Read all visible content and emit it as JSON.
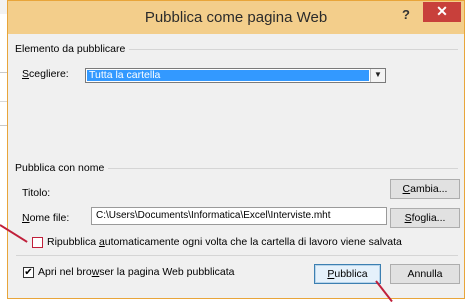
{
  "dialog": {
    "title": "Pubblica come pagina Web",
    "help_label": "?",
    "close_label": "✕"
  },
  "section_publish": {
    "group_label": "Elemento da pubblicare",
    "choose_label": "Scegliere:",
    "choose_label_accel": "S",
    "choose_label_rest": "cegliere:",
    "selected_value": "Tutta la cartella",
    "dropdown_arrow": "▼"
  },
  "section_name": {
    "group_label": "Pubblica con nome",
    "title_label": "Titolo:",
    "change_button": "Cambia...",
    "change_accel": "C",
    "change_rest": "ambia...",
    "filename_label_accel": "N",
    "filename_label_rest": "ome file:",
    "filename_value": "C:\\Users\\Documents\\Informatica\\Excel\\Interviste.mht",
    "browse_accel": "S",
    "browse_rest_pre": "",
    "browse_rest": "foglia...",
    "auto_republish_pre": "Ripubblica ",
    "auto_republish_accel": "a",
    "auto_republish_post": "utomaticamente ogni volta che la cartella di lavoro viene salvata",
    "auto_republish_checked": false
  },
  "footer": {
    "open_browser_pre": "Apri nel bro",
    "open_browser_accel": "w",
    "open_browser_post": "ser la pagina Web pubblicata",
    "open_browser_checked": true,
    "publish_accel": "P",
    "publish_rest": "ubblica",
    "cancel_button": "Annulla"
  },
  "colors": {
    "title_bar": "#f3ce8b",
    "close_button": "#c8403b",
    "selection": "#3399ff",
    "pointer": "#c0203b"
  }
}
